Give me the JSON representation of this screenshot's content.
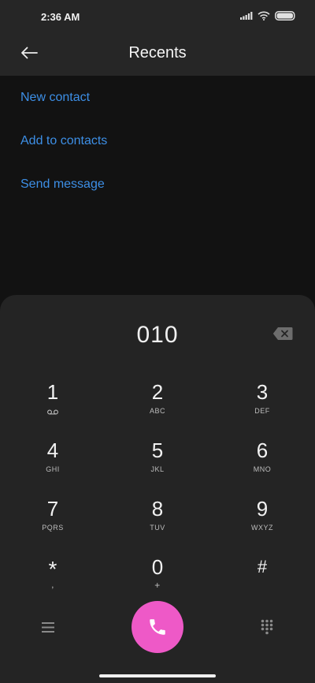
{
  "status_bar": {
    "time": "2:36 AM",
    "icons": [
      "signal-icon",
      "wifi-icon",
      "battery-icon"
    ]
  },
  "header": {
    "title": "Recents",
    "back_icon": "back-arrow-icon"
  },
  "actions": [
    {
      "label": "New contact"
    },
    {
      "label": "Add to contacts"
    },
    {
      "label": "Send message"
    }
  ],
  "dialpad": {
    "number": "010",
    "keys": [
      {
        "digit": "1",
        "letters": ""
      },
      {
        "digit": "2",
        "letters": "ABC"
      },
      {
        "digit": "3",
        "letters": "DEF"
      },
      {
        "digit": "4",
        "letters": "GHI"
      },
      {
        "digit": "5",
        "letters": "JKL"
      },
      {
        "digit": "6",
        "letters": "MNO"
      },
      {
        "digit": "7",
        "letters": "PQRS"
      },
      {
        "digit": "8",
        "letters": "TUV"
      },
      {
        "digit": "9",
        "letters": "WXYZ"
      },
      {
        "digit": "*",
        "letters": ","
      },
      {
        "digit": "0",
        "letters": "+"
      },
      {
        "digit": "#",
        "letters": ""
      }
    ]
  },
  "colors": {
    "accent_link": "#3d8fe6",
    "call_button": "#ee59c7",
    "background": "#121212",
    "header": "#262626",
    "dialpad": "#242424"
  }
}
